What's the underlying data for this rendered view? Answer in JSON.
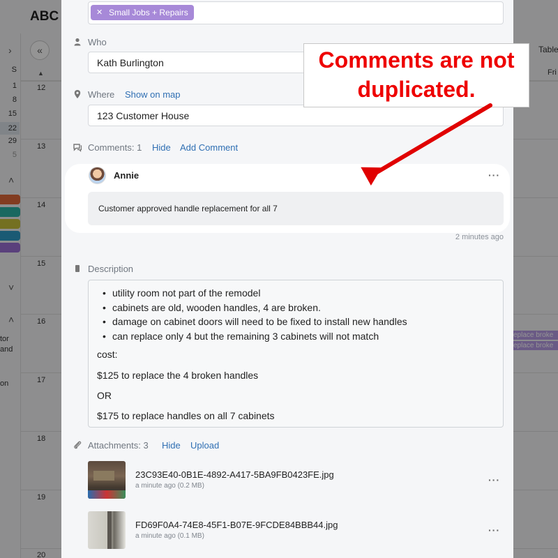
{
  "background": {
    "app_title": "ABC",
    "table_tab": "Table",
    "weekday_fri": "Fri",
    "mini_calendar": {
      "weekday_header": "S",
      "dates": [
        "1",
        "8",
        "15",
        "22",
        "29",
        "5"
      ]
    },
    "row_numbers": [
      "12",
      "13",
      "14",
      "15",
      "16",
      "17",
      "18",
      "19",
      "20"
    ],
    "sidebar_text": [
      "tor",
      "and",
      "on"
    ],
    "event_labels": [
      "eplace broke",
      "eplace broke"
    ],
    "colors": [
      "#e0683a",
      "#2bb3a6",
      "#c9c13a",
      "#2e9cc9",
      "#9b6fd6"
    ]
  },
  "modal": {
    "tag_label": "Small Jobs + Repairs",
    "who": {
      "label": "Who",
      "value": "Kath Burlington"
    },
    "where": {
      "label": "Where",
      "link": "Show on map",
      "value": "123 Customer House"
    },
    "comments": {
      "label": "Comments: 1",
      "hide": "Hide",
      "add": "Add Comment",
      "items": [
        {
          "author": "Annie",
          "text": "Customer approved handle replacement for all 7",
          "time": "2 minutes ago"
        }
      ]
    },
    "description": {
      "label": "Description",
      "bullets": [
        "utility room not part of the remodel",
        "cabinets are old, wooden handles, 4 are broken.",
        "damage on cabinet doors will need to be fixed to install new handles",
        "can replace only 4 but the remaining 3 cabinets will not match"
      ],
      "lines": [
        "cost:",
        "$125 to replace the 4 broken handles",
        "OR",
        "$175 to replace handles on all 7 cabinets"
      ]
    },
    "attachments": {
      "label": "Attachments: 3",
      "hide": "Hide",
      "upload": "Upload",
      "items": [
        {
          "name": "23C93E40-0B1E-4892-A417-5BA9FB0423FE.jpg",
          "meta": "a minute ago (0.2 MB)"
        },
        {
          "name": "FD69F0A4-74E8-45F1-B07E-9FCDE84BBB44.jpg",
          "meta": "a minute ago (0.1 MB)"
        }
      ]
    }
  },
  "annotation": {
    "line1": "Comments are not",
    "line2": "duplicated.",
    "color": "#e00000"
  }
}
